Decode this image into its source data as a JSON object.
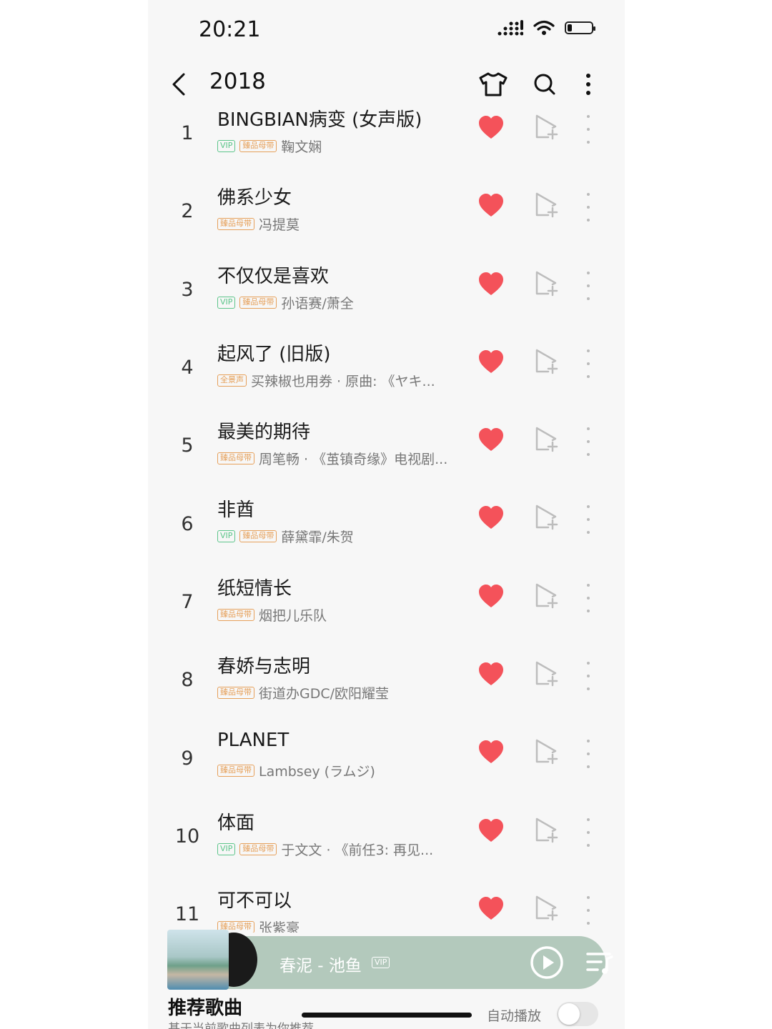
{
  "status_bar": {
    "time": "20:21",
    "battery_level": 0.2
  },
  "header": {
    "title": "2018",
    "icons": [
      "back-icon",
      "tshirt-icon",
      "search-icon",
      "more-vertical-icon"
    ]
  },
  "songs": [
    {
      "num": "1",
      "title": "BINGBIAN病变 (女声版)",
      "vip": true,
      "master": true,
      "master_label": "臻品母带",
      "vip_label": "VIP",
      "artist": "鞠文娴"
    },
    {
      "num": "2",
      "title": "佛系少女",
      "vip": false,
      "master": true,
      "master_label": "臻品母带",
      "vip_label": "VIP",
      "artist": "冯提莫"
    },
    {
      "num": "3",
      "title": "不仅仅是喜欢",
      "vip": true,
      "master": true,
      "master_label": "臻品母带",
      "vip_label": "VIP",
      "artist": "孙语赛/萧全"
    },
    {
      "num": "4",
      "title": "起风了 (旧版)",
      "vip": false,
      "master": true,
      "master_label": "全景声",
      "vip_label": "VIP",
      "artist": "买辣椒也用券 · 原曲: 《ヤキ..."
    },
    {
      "num": "5",
      "title": "最美的期待",
      "vip": false,
      "master": true,
      "master_label": "臻品母带",
      "vip_label": "VIP",
      "artist": "周笔畅 · 《茧镇奇缘》电视剧..."
    },
    {
      "num": "6",
      "title": "非酋",
      "vip": true,
      "master": true,
      "master_label": "臻品母带",
      "vip_label": "VIP",
      "artist": "薛黛霏/朱贺"
    },
    {
      "num": "7",
      "title": "纸短情长",
      "vip": false,
      "master": true,
      "master_label": "臻品母带",
      "vip_label": "VIP",
      "artist": "烟把儿乐队"
    },
    {
      "num": "8",
      "title": "春娇与志明",
      "vip": false,
      "master": true,
      "master_label": "臻品母带",
      "vip_label": "VIP",
      "artist": "街道办GDC/欧阳耀莹"
    },
    {
      "num": "9",
      "title": "PLANET",
      "vip": false,
      "master": true,
      "master_label": "臻品母带",
      "vip_label": "VIP",
      "artist": "Lambsey (ラムジ)"
    },
    {
      "num": "10",
      "title": "体面",
      "vip": true,
      "master": true,
      "master_label": "臻品母带",
      "vip_label": "VIP",
      "artist": "于文文 · 《前任3: 再见..."
    },
    {
      "num": "11",
      "title": "可不可以",
      "vip": false,
      "master": true,
      "master_label": "臻品母带",
      "vip_label": "VIP",
      "artist": "张紫豪"
    }
  ],
  "player": {
    "title": "春泥 - 池鱼",
    "vip_label": "VIP"
  },
  "recommend": {
    "title": "推荐歌曲",
    "subtitle": "基于当前歌曲列表为你推荐",
    "autoplay_label": "自动播放",
    "autoplay_on": false
  },
  "colors": {
    "heart": "#f4525a",
    "vip": "#5cc58a",
    "master": "#e6a05a",
    "player_bg": "#b3c9bc"
  }
}
